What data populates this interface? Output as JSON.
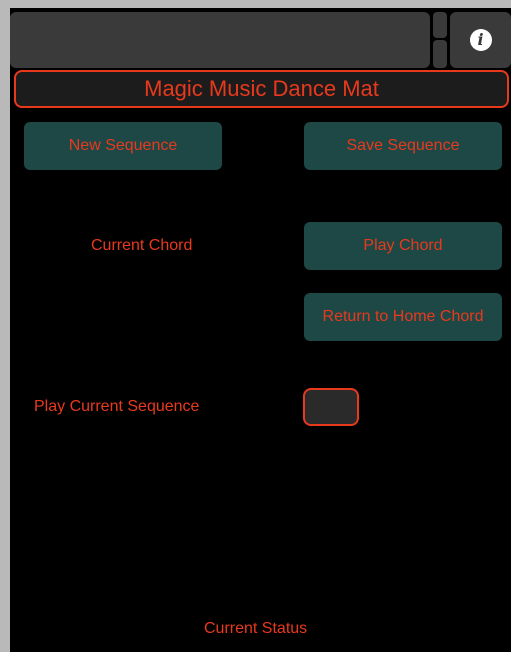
{
  "app": {
    "title": "Magic Music Dance Mat"
  },
  "toolbar": {
    "info_icon": "i"
  },
  "buttons": {
    "new_sequence": "New Sequence",
    "save_sequence": "Save Sequence",
    "play_chord": "Play Chord",
    "return_home_chord": "Return to Home Chord"
  },
  "labels": {
    "current_chord": "Current Chord",
    "play_current_sequence": "Play Current Sequence",
    "current_status": "Current Status"
  },
  "colors": {
    "accent": "#e8391d",
    "button_bg": "#1d4845",
    "panel_bg": "#3a3a3a",
    "background": "#000000"
  },
  "icons": [
    "info-icon"
  ]
}
